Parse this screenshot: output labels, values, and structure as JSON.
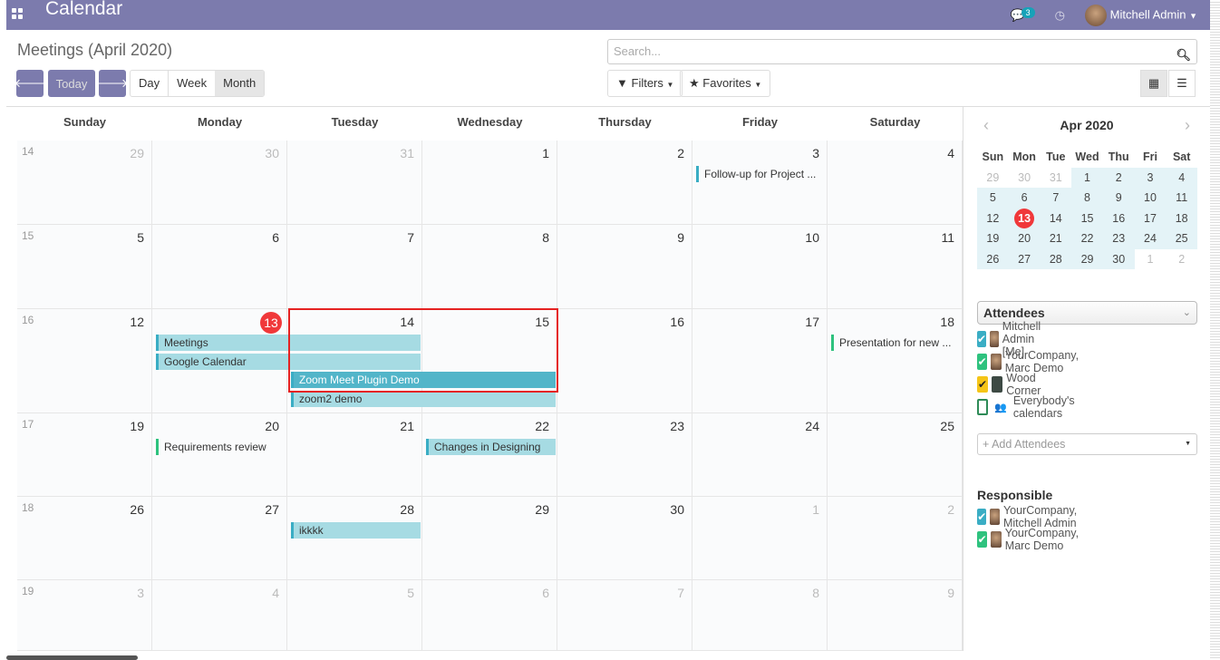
{
  "topbar": {
    "title": "Calendar",
    "messages_count": "3",
    "user": "Mitchell Admin",
    "color": "#7c7bad"
  },
  "control": {
    "title": "Meetings (April 2020)",
    "today": "Today",
    "day": "Day",
    "week": "Week",
    "month": "Month",
    "search_placeholder": "Search...",
    "filters": "Filters",
    "favorites": "Favorites"
  },
  "calendar": {
    "weekdays": [
      "Sunday",
      "Monday",
      "Tuesday",
      "Wednesday",
      "Thursday",
      "Friday",
      "Saturday"
    ],
    "today": "2020-04-13",
    "weeks": [
      {
        "num": "14",
        "days": [
          [
            29,
            0
          ],
          [
            30,
            0
          ],
          [
            31,
            0
          ],
          [
            1,
            1
          ],
          [
            2,
            1
          ],
          [
            3,
            1
          ],
          [
            4,
            1
          ]
        ]
      },
      {
        "num": "15",
        "days": [
          [
            5,
            1
          ],
          [
            6,
            1
          ],
          [
            7,
            1
          ],
          [
            8,
            1
          ],
          [
            9,
            1
          ],
          [
            10,
            1
          ],
          [
            11,
            1
          ]
        ]
      },
      {
        "num": "16",
        "days": [
          [
            12,
            1
          ],
          [
            13,
            1
          ],
          [
            14,
            1
          ],
          [
            15,
            1
          ],
          [
            16,
            1
          ],
          [
            17,
            1
          ],
          [
            18,
            1
          ]
        ]
      },
      {
        "num": "17",
        "days": [
          [
            19,
            1
          ],
          [
            20,
            1
          ],
          [
            21,
            1
          ],
          [
            22,
            1
          ],
          [
            23,
            1
          ],
          [
            24,
            1
          ],
          [
            25,
            1
          ]
        ]
      },
      {
        "num": "18",
        "days": [
          [
            26,
            1
          ],
          [
            27,
            1
          ],
          [
            28,
            1
          ],
          [
            29,
            1
          ],
          [
            30,
            1
          ],
          [
            1,
            0
          ],
          [
            2,
            0
          ]
        ]
      },
      {
        "num": "19",
        "days": [
          [
            3,
            0
          ],
          [
            4,
            0
          ],
          [
            5,
            0
          ],
          [
            6,
            0
          ],
          [
            7,
            0
          ],
          [
            8,
            0
          ],
          [
            9,
            0
          ]
        ]
      }
    ],
    "events": [
      {
        "title": "Follow-up for Project ...",
        "start": 3,
        "end": 3,
        "allday": false,
        "color": "#3aadc4"
      },
      {
        "title": "Meetings",
        "start": 13,
        "end": 14,
        "allday": true,
        "color": "#3aadc4"
      },
      {
        "title": "Google Calendar",
        "start": 13,
        "end": 14,
        "allday": true,
        "color": "#3aadc4"
      },
      {
        "title": "Zoom Meet Plugin Demo",
        "start": 14,
        "end": 15,
        "allday": true,
        "selected": true,
        "color": "#3aadc4"
      },
      {
        "title": "zoom2 demo",
        "start": 14,
        "end": 15,
        "allday": true,
        "color": "#3aadc4"
      },
      {
        "title": "Presentation for new ...",
        "start": 18,
        "end": 18,
        "allday": false,
        "color": "#2ec27e"
      },
      {
        "title": "Requirements review",
        "start": 20,
        "end": 20,
        "allday": false,
        "color": "#2ec27e"
      },
      {
        "title": "Changes in Designing",
        "start": 22,
        "end": 22,
        "allday": true,
        "color": "#3aadc4"
      },
      {
        "title": "ikkkk",
        "start": 28,
        "end": 28,
        "allday": true,
        "color": "#3aadc4"
      }
    ]
  },
  "mini": {
    "title": "Apr 2020",
    "heads": [
      "Sun",
      "Mon",
      "Tue",
      "Wed",
      "Thu",
      "Fri",
      "Sat"
    ]
  },
  "filters": {
    "attendees_label": "Attendees",
    "attendees": [
      {
        "name": "Mitchell Admin [Me]",
        "color": "#3aadc4",
        "checked": true
      },
      {
        "name": "YourCompany, Marc Demo",
        "color": "#2ec27e",
        "checked": true
      },
      {
        "name": "Wood Corner",
        "color": "#f5c518",
        "checked": true
      },
      {
        "name": "Everybody's calendars",
        "color": "#ffffff",
        "checked": false
      }
    ],
    "add_placeholder": "+ Add Attendees",
    "responsible_label": "Responsible",
    "responsible": [
      {
        "name": "YourCompany, Mitchell Admin",
        "color": "#3aadc4"
      },
      {
        "name": "YourCompany, Marc Demo",
        "color": "#2ec27e"
      }
    ]
  }
}
